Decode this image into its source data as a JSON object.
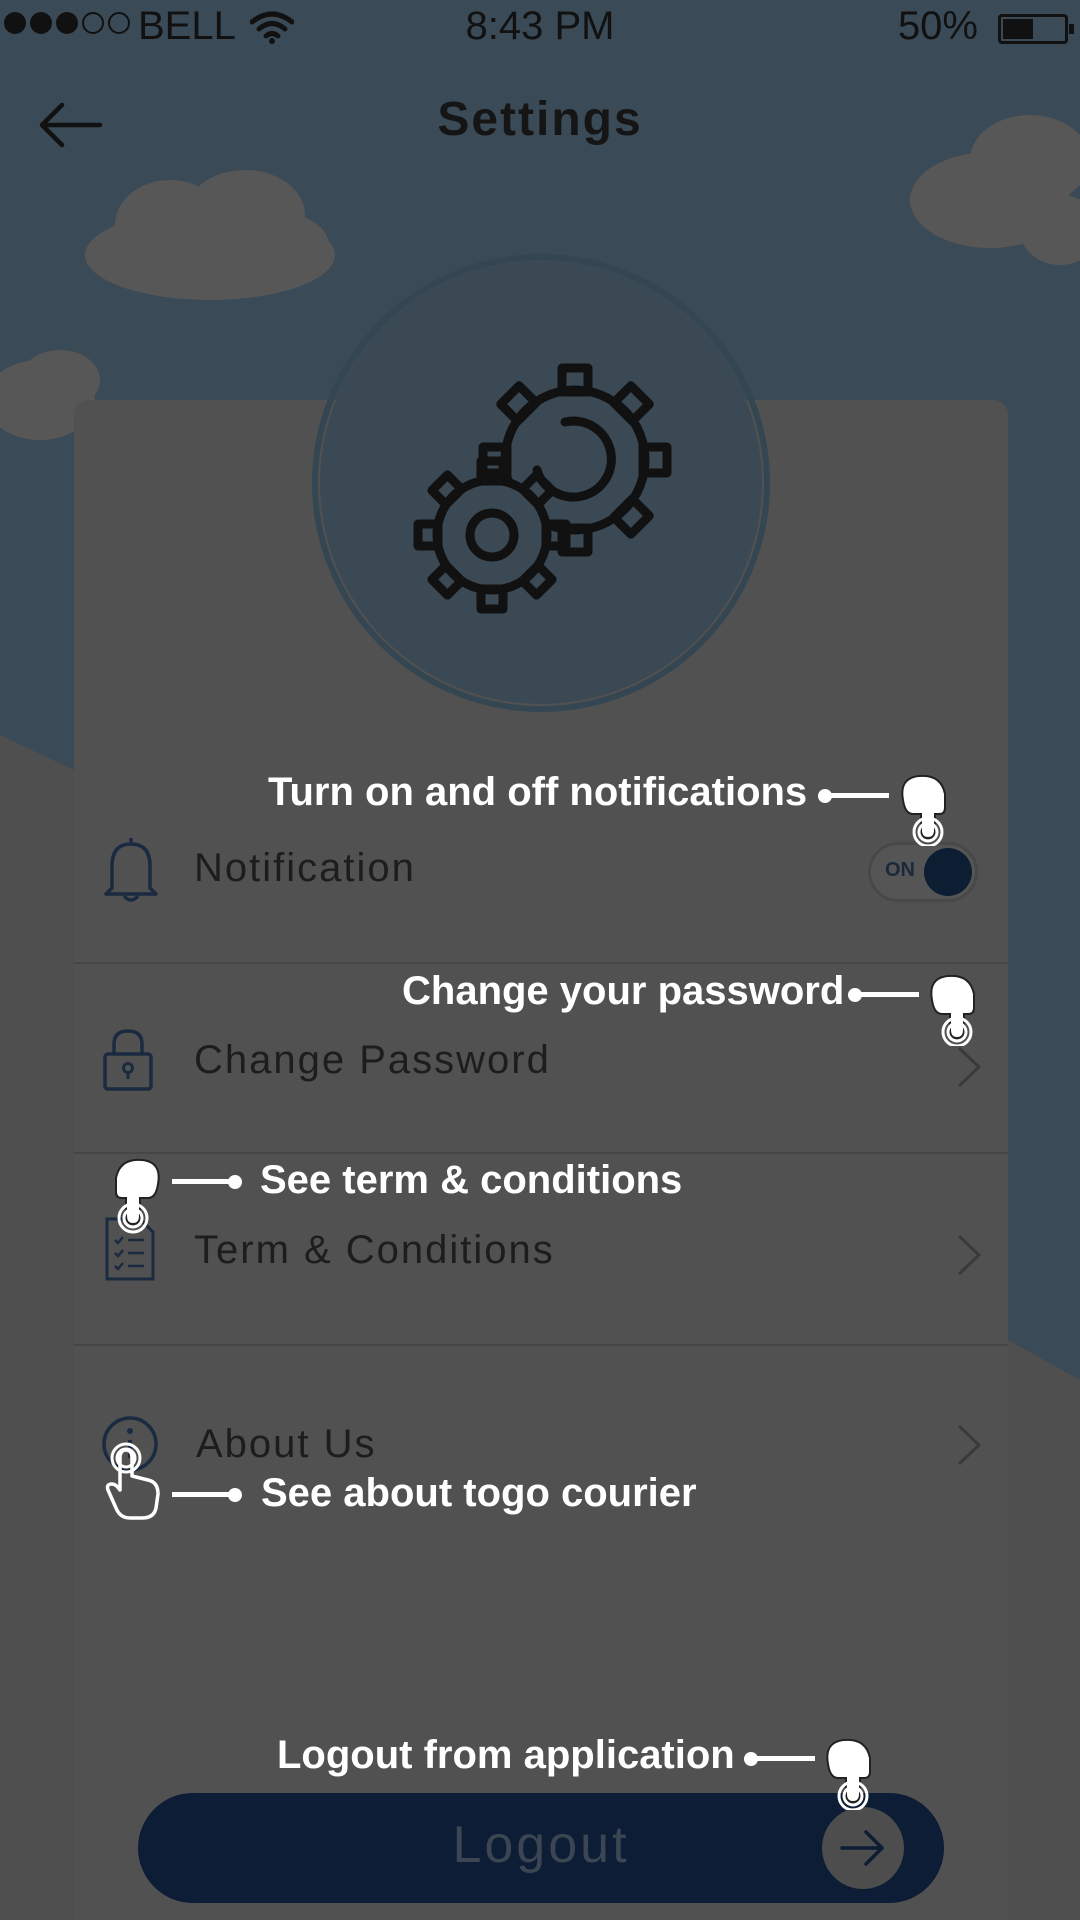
{
  "status_bar": {
    "carrier": "BELL",
    "time": "8:43 PM",
    "battery_percent": "50%",
    "signal_bars_filled": 3,
    "signal_bars_total": 5,
    "battery_level": 0.5
  },
  "header": {
    "title": "Settings",
    "back_icon": "arrow-left-icon"
  },
  "hero": {
    "icon": "gears-icon"
  },
  "settings": {
    "items": [
      {
        "label": "Notification",
        "icon": "bell-icon",
        "control": "toggle",
        "toggle_text": "ON",
        "toggle_state": true
      },
      {
        "label": "Change Password",
        "icon": "lock-icon",
        "control": "chevron"
      },
      {
        "label": "Term & Conditions",
        "icon": "checklist-icon",
        "control": "chevron"
      },
      {
        "label": "About Us",
        "icon": "info-icon",
        "control": "chevron"
      }
    ]
  },
  "logout": {
    "label": "Logout",
    "icon": "arrow-right-icon"
  },
  "hints": {
    "notification": "Turn on and off notifications",
    "password": "Change your password",
    "terms": "See term & conditions",
    "about": "See about togo courier",
    "logout": "Logout from application"
  },
  "colors": {
    "overlay_sky": "#3a4a56",
    "card": "#515151",
    "accent_navy": "#0c1d35",
    "hint_text": "#ffffff"
  }
}
